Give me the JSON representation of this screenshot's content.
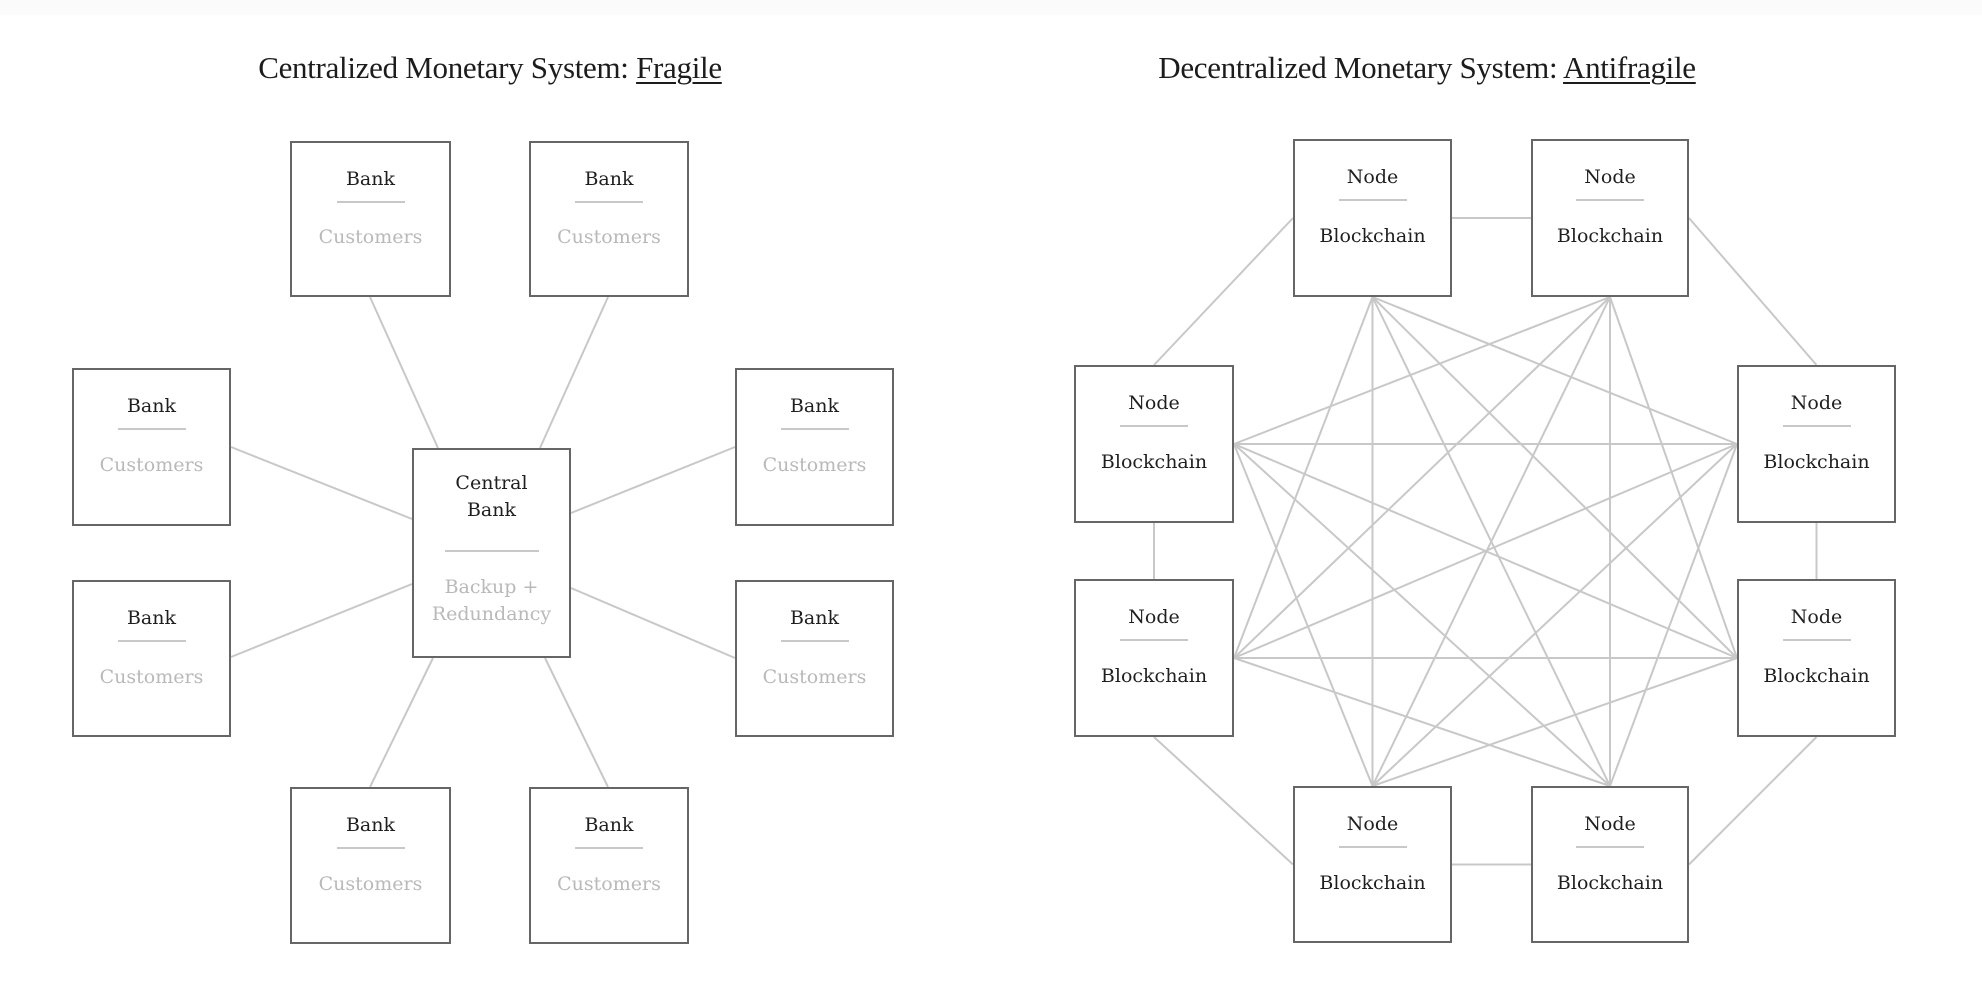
{
  "diagrams": [
    {
      "id": "centralized",
      "title_prefix": "Centralized Monetary System: ",
      "title_qualifier": "Fragile",
      "hub": {
        "primary": "Central Bank",
        "secondary": "Backup + Redundancy"
      },
      "satellites": [
        {
          "position": "top-left",
          "primary": "Bank",
          "secondary": "Customers"
        },
        {
          "position": "top-right",
          "primary": "Bank",
          "secondary": "Customers"
        },
        {
          "position": "right-upper",
          "primary": "Bank",
          "secondary": "Customers"
        },
        {
          "position": "right-lower",
          "primary": "Bank",
          "secondary": "Customers"
        },
        {
          "position": "bottom-right",
          "primary": "Bank",
          "secondary": "Customers"
        },
        {
          "position": "bottom-left",
          "primary": "Bank",
          "secondary": "Customers"
        },
        {
          "position": "left-lower",
          "primary": "Bank",
          "secondary": "Customers"
        },
        {
          "position": "left-upper",
          "primary": "Bank",
          "secondary": "Customers"
        }
      ],
      "topology": "star",
      "edges": [
        [
          "hub",
          "top-left"
        ],
        [
          "hub",
          "top-right"
        ],
        [
          "hub",
          "right-upper"
        ],
        [
          "hub",
          "right-lower"
        ],
        [
          "hub",
          "bottom-right"
        ],
        [
          "hub",
          "bottom-left"
        ],
        [
          "hub",
          "left-lower"
        ],
        [
          "hub",
          "left-upper"
        ]
      ]
    },
    {
      "id": "decentralized",
      "title_prefix": "Decentralized Monetary System: ",
      "title_qualifier": "Antifragile",
      "nodes": [
        {
          "position": "top-left",
          "primary": "Node",
          "secondary": "Blockchain"
        },
        {
          "position": "top-right",
          "primary": "Node",
          "secondary": "Blockchain"
        },
        {
          "position": "right-upper",
          "primary": "Node",
          "secondary": "Blockchain"
        },
        {
          "position": "right-lower",
          "primary": "Node",
          "secondary": "Blockchain"
        },
        {
          "position": "bottom-right",
          "primary": "Node",
          "secondary": "Blockchain"
        },
        {
          "position": "bottom-left",
          "primary": "Node",
          "secondary": "Blockchain"
        },
        {
          "position": "left-lower",
          "primary": "Node",
          "secondary": "Blockchain"
        },
        {
          "position": "left-upper",
          "primary": "Node",
          "secondary": "Blockchain"
        }
      ],
      "topology": "full-mesh"
    }
  ],
  "colors": {
    "title_text": "#1c1c1c",
    "box_border": "#666666",
    "connector": "#c8c8c8",
    "primary_text": "#1f1f1f",
    "muted_text": "#b9b9b9"
  }
}
